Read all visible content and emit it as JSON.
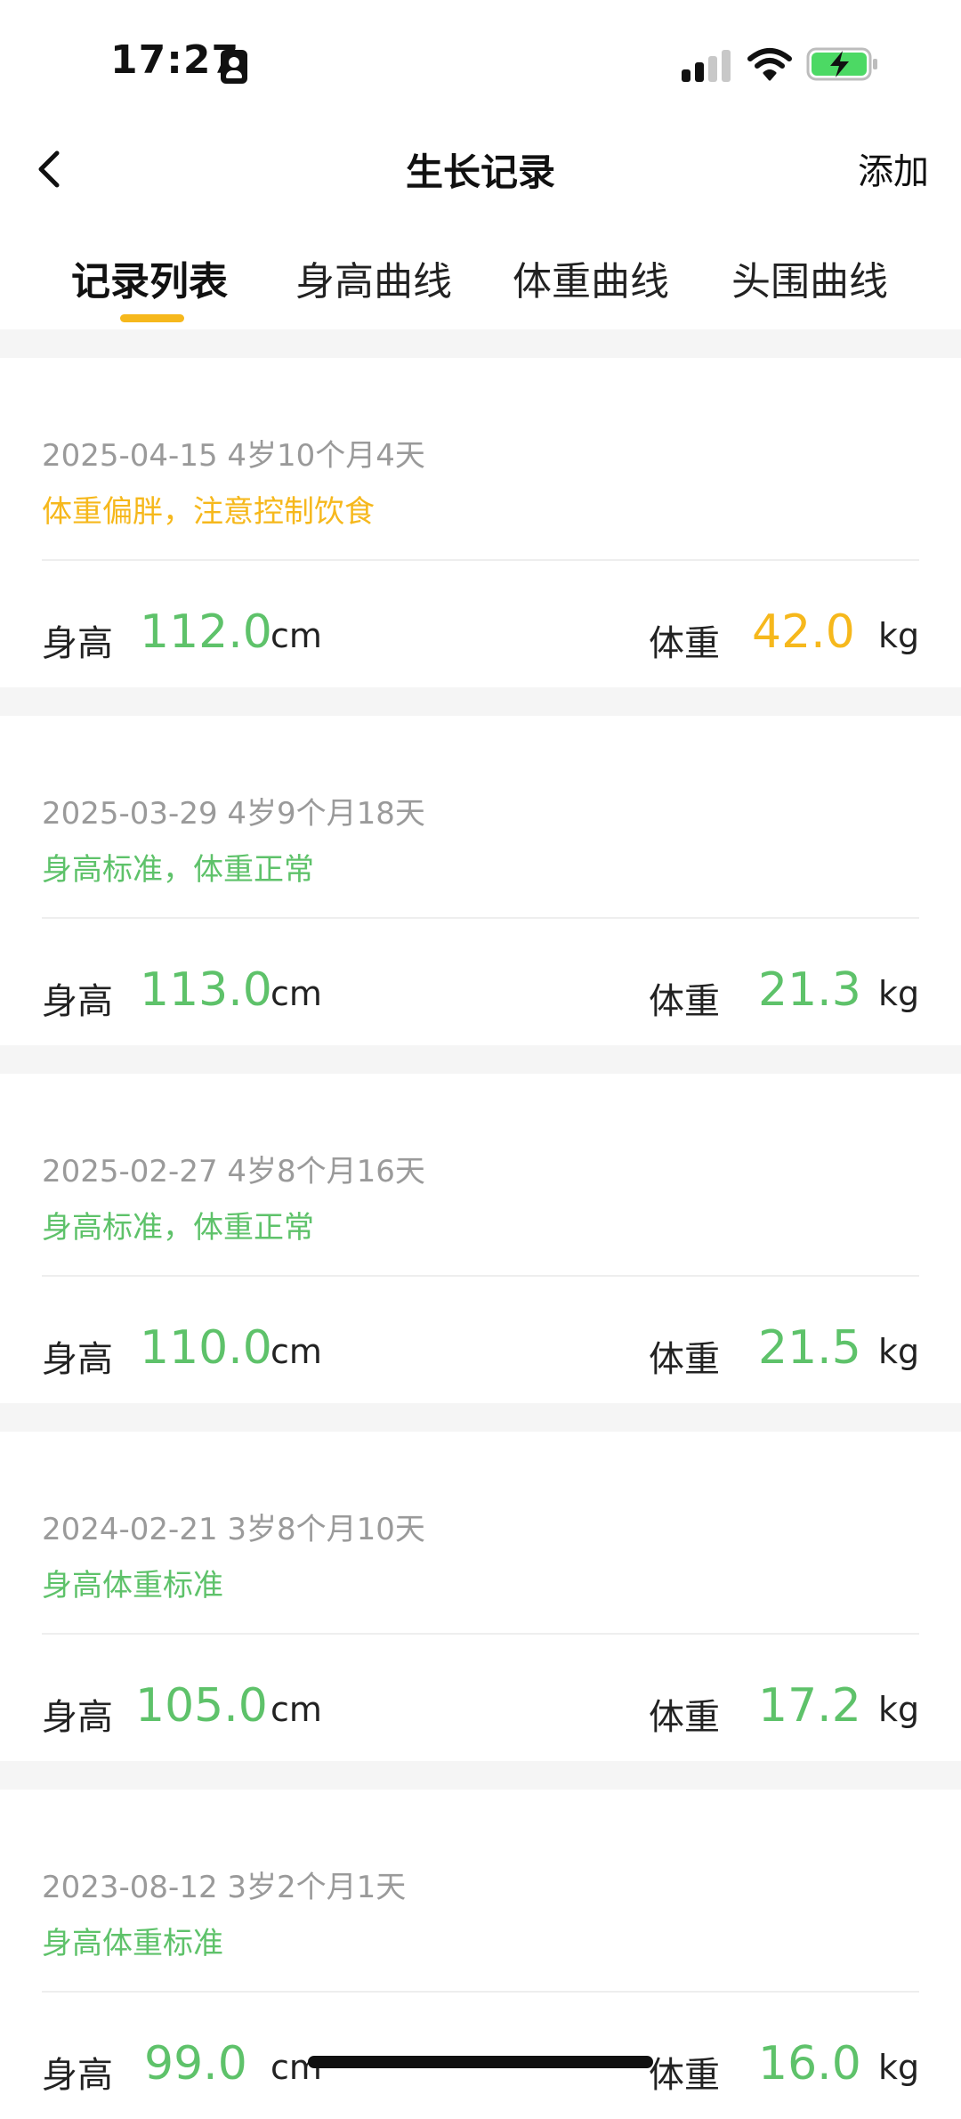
{
  "status_bar": {
    "time": "17:27"
  },
  "nav": {
    "title": "生长记录",
    "add_label": "添加"
  },
  "tabs": [
    {
      "label": "记录列表",
      "active": true
    },
    {
      "label": "身高曲线",
      "active": false
    },
    {
      "label": "体重曲线",
      "active": false
    },
    {
      "label": "头围曲线",
      "active": false
    }
  ],
  "labels": {
    "height": "身高",
    "weight": "体重",
    "height_unit": "cm",
    "weight_unit": "kg"
  },
  "colors": {
    "green": "#5ec26a",
    "orange": "#f6b81c",
    "gray_text": "#9a9a9a"
  },
  "records": [
    {
      "date": "2025-04-15 4岁10个月4天",
      "status": "体重偏胖，注意控制饮食",
      "status_color": "#f6b81c",
      "height": "112.0",
      "height_color": "#5ec26a",
      "weight": "42.0",
      "weight_color": "#f6b81c"
    },
    {
      "date": "2025-03-29 4岁9个月18天",
      "status": "身高标准，体重正常",
      "status_color": "#5ec26a",
      "height": "113.0",
      "height_color": "#5ec26a",
      "weight": "21.3",
      "weight_color": "#5ec26a"
    },
    {
      "date": "2025-02-27 4岁8个月16天",
      "status": "身高标准，体重正常",
      "status_color": "#5ec26a",
      "height": "110.0",
      "height_color": "#5ec26a",
      "weight": "21.5",
      "weight_color": "#5ec26a"
    },
    {
      "date": "2024-02-21 3岁8个月10天",
      "status": "身高体重标准",
      "status_color": "#5ec26a",
      "height": "105.0",
      "height_color": "#5ec26a",
      "weight": "17.2",
      "weight_color": "#5ec26a"
    },
    {
      "date": "2023-08-12 3岁2个月1天",
      "status": "身高体重标准",
      "status_color": "#5ec26a",
      "height": "99.0",
      "height_color": "#5ec26a",
      "weight": "16.0",
      "weight_color": "#5ec26a"
    }
  ]
}
